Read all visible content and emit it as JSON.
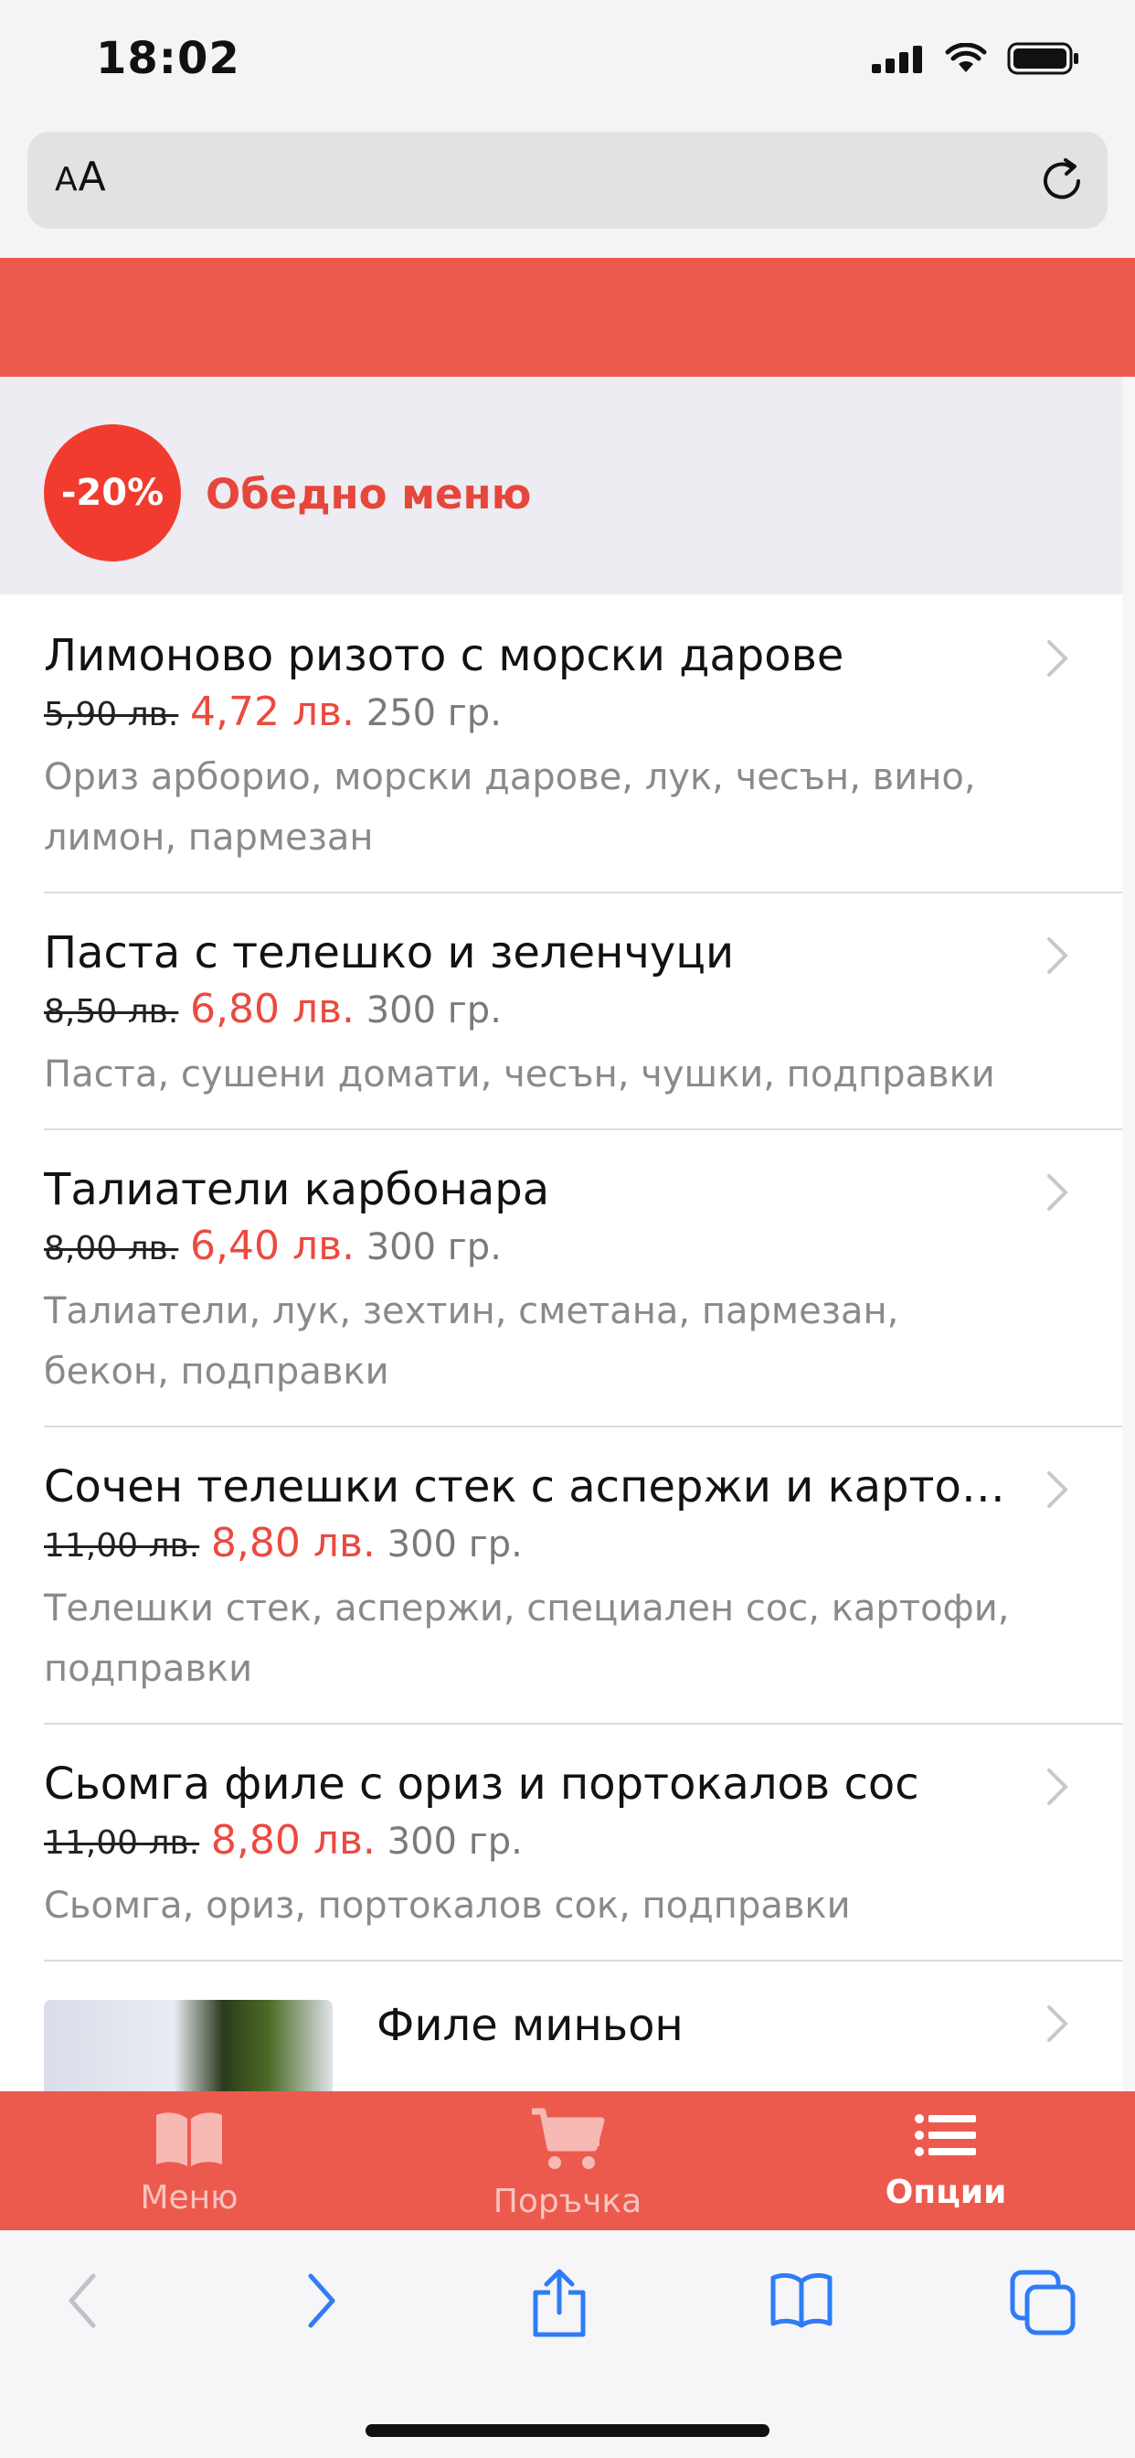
{
  "status_bar": {
    "time": "18:02",
    "icons": [
      "signal-icon",
      "wifi-icon",
      "battery-icon"
    ]
  },
  "url_bar": {
    "text_size_label_small": "A",
    "text_size_label_large": "A",
    "reload_icon": "reload-icon"
  },
  "category": {
    "discount": "-20%",
    "title": "Обедно меню"
  },
  "menu_items": [
    {
      "name": "Лимоново ризото с морски дарове",
      "old_price": "5,90 лв.",
      "new_price": "4,72 лв.",
      "weight": "250 гр.",
      "description": "Ориз арборио, морски дарове, лук, чесън, вино, лимон, пармезан"
    },
    {
      "name": "Паста с телешко и зеленчуци",
      "old_price": "8,50 лв.",
      "new_price": "6,80 лв.",
      "weight": "300 гр.",
      "description": "Паста, сушени домати, чесън, чушки, подправки"
    },
    {
      "name": "Талиатели карбонара",
      "old_price": "8,00 лв.",
      "new_price": "6,40 лв.",
      "weight": "300 гр.",
      "description": "Талиатели, лук, зехтин, сметана, пармезан, бекон, подправки"
    },
    {
      "name": "Сочен телешки стек с аспержи и картофи",
      "old_price": "11,00 лв.",
      "new_price": "8,80 лв.",
      "weight": "300 гр.",
      "description": "Телешки стек, аспержи, специален сос, картофи, подправки"
    },
    {
      "name": "Сьомга филе с ориз и портокалов сос",
      "old_price": "11,00 лв.",
      "new_price": "8,80 лв.",
      "weight": "300 гр.",
      "description": "Сьомга, ориз, портокалов сок, подправки"
    },
    {
      "name": "Филе миньон"
    }
  ],
  "tabbar": {
    "tabs": [
      {
        "label": "Меню",
        "icon": "book-icon",
        "active": false
      },
      {
        "label": "Поръчка",
        "icon": "cart-icon",
        "active": false
      },
      {
        "label": "Опции",
        "icon": "list-icon",
        "active": true
      }
    ]
  },
  "safari_toolbar": {
    "buttons": [
      "back-icon",
      "forward-icon",
      "share-icon",
      "bookmarks-icon",
      "tabs-icon"
    ]
  },
  "colors": {
    "brand_red": "#ec5a4e",
    "discount_red": "#f23b2f",
    "price_red": "#ec4a3f",
    "category_bg": "#ececf2",
    "ios_blue": "#2f7cf6"
  }
}
